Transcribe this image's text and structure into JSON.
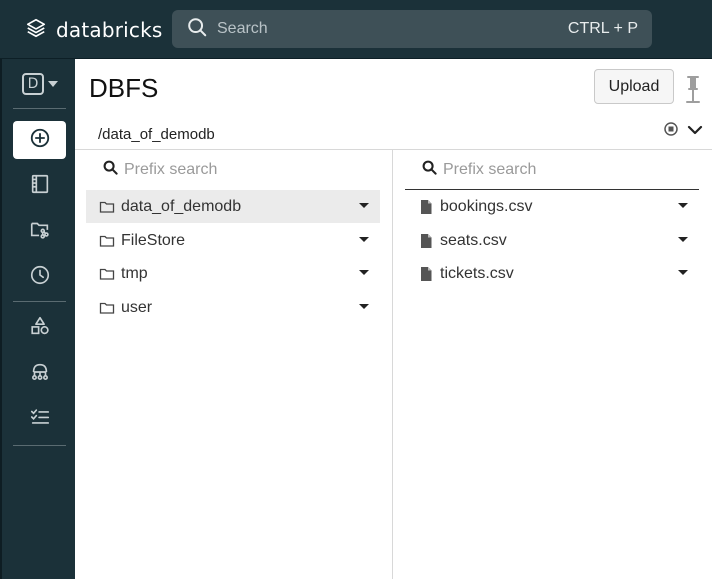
{
  "app": {
    "brand": "databricks"
  },
  "search": {
    "placeholder": "Search",
    "shortcut": "CTRL + P"
  },
  "sidebar": {
    "workspace_letter": "D",
    "items": [
      {
        "icon": "plus-circle-icon",
        "active": true
      },
      {
        "icon": "notebook-icon"
      },
      {
        "icon": "repos-icon"
      },
      {
        "icon": "clock-icon"
      },
      {
        "icon": "shapes-icon"
      },
      {
        "icon": "cluster-icon"
      },
      {
        "icon": "jobs-checklist-icon"
      }
    ]
  },
  "main": {
    "title": "DBFS",
    "upload_label": "Upload",
    "path": "/data_of_demodb",
    "left_column": {
      "search_placeholder": "Prefix search",
      "folders": [
        {
          "name": "data_of_demodb",
          "selected": true
        },
        {
          "name": "FileStore"
        },
        {
          "name": "tmp"
        },
        {
          "name": "user"
        }
      ]
    },
    "right_column": {
      "search_placeholder": "Prefix search",
      "files": [
        {
          "name": "bookings.csv"
        },
        {
          "name": "seats.csv"
        },
        {
          "name": "tickets.csv"
        }
      ]
    }
  },
  "colors": {
    "sidebar_bg": "#1b3139",
    "search_bg": "#3e5057",
    "panel_bg": "#ffffff",
    "selected_row": "#ebebeb"
  }
}
